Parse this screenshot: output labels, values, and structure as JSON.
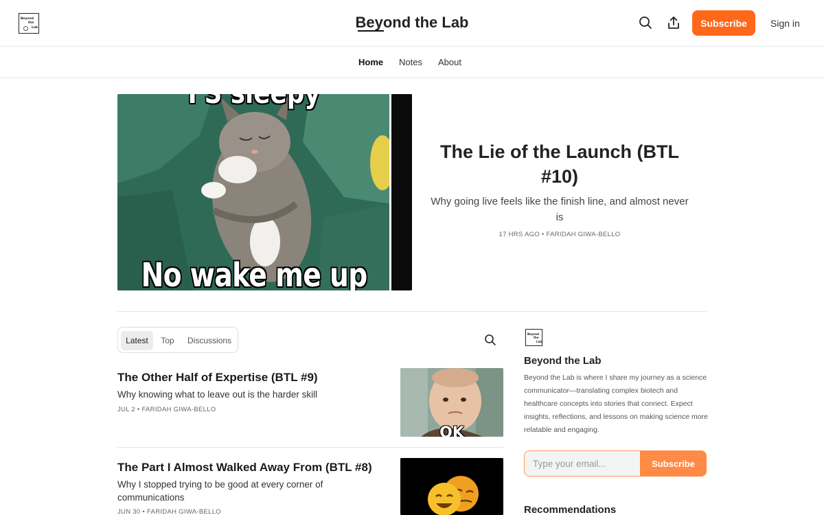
{
  "header": {
    "logo_lines": [
      "Beyond",
      "the",
      "Lab"
    ],
    "site_title": "Beyond the Lab",
    "search_icon": "search-icon",
    "share_icon": "share-icon",
    "subscribe_label": "Subscribe",
    "signin_label": "Sign in"
  },
  "nav": {
    "items": [
      {
        "label": "Home",
        "active": true
      },
      {
        "label": "Notes",
        "active": false
      },
      {
        "label": "About",
        "active": false
      }
    ]
  },
  "hero": {
    "image_caption_top": "I'S sleepy",
    "image_caption_bottom": "No wake me up",
    "title": "The Lie of the Launch (BTL #10)",
    "subtitle": "Why going live feels like the finish line, and almost never is",
    "meta": "17 HRS AGO • FARIDAH GIWA-BELLO"
  },
  "tabs": {
    "items": [
      "Latest",
      "Top",
      "Discussions"
    ],
    "active": "Latest",
    "search_icon": "search-icon"
  },
  "posts": [
    {
      "title": "The Other Half of Expertise (BTL #9)",
      "subtitle": "Why knowing what to leave out is the harder skill",
      "meta": "JUL 2 • FARIDAH GIWA-BELLO",
      "thumb_caption": "OK"
    },
    {
      "title": "The Part I Almost Walked Away From (BTL #8)",
      "subtitle": "Why I stopped trying to be good at every corner of communications",
      "meta": "JUN 30 • FARIDAH GIWA-BELLO"
    }
  ],
  "sidebar": {
    "logo_lines": [
      "Beyond",
      "the",
      "Lab"
    ],
    "title": "Beyond the Lab",
    "description": "Beyond the Lab is where I share my journey as a science communicator—translating complex biotech and healthcare concepts into stories that connect. Expect insights, reflections, and lessons on making science more relatable and engaging.",
    "email_placeholder": "Type your email...",
    "subscribe_label": "Subscribe",
    "recommendations_heading": "Recommendations"
  },
  "colors": {
    "accent": "#ff6719",
    "accent_light": "#ff8a45"
  }
}
